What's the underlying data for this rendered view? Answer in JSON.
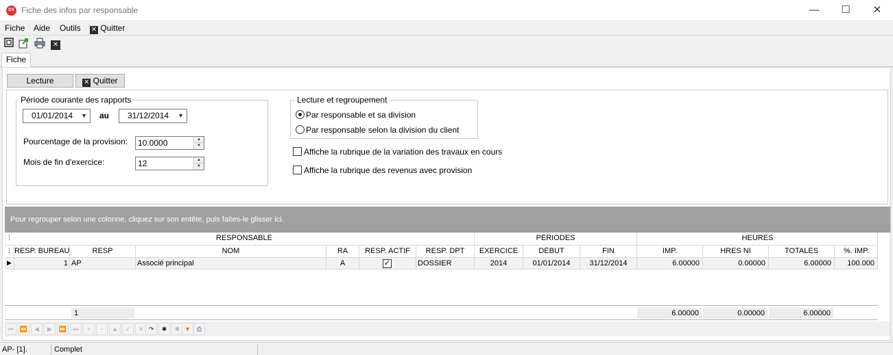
{
  "window": {
    "app_icon_text": "OX",
    "title": "Fiche des infos par responsable",
    "minimize": "—",
    "maximize": "☐",
    "close": "✕"
  },
  "menu": {
    "fiche": "Fiche",
    "aide": "Aide",
    "outils": "Outils",
    "quitter": "Quitter"
  },
  "toolbar": {
    "icons": [
      "frame-icon",
      "export-icon",
      "print-icon",
      "close-icon"
    ]
  },
  "tabs": {
    "fiche": "Fiche"
  },
  "actions": {
    "lecture": "Lecture",
    "quitter": "Quitter"
  },
  "periode": {
    "title": "Période courante des rapports",
    "start": "01/01/2014",
    "au": "au",
    "end": "31/12/2014",
    "provision_label": "Pourcentage de la provision:",
    "provision_value": "10.0000",
    "mois_label": "Mois de fin d'exercice:",
    "mois_value": "12"
  },
  "regroupement": {
    "title": "Lecture et regroupement",
    "option1": "Par responsable et sa division",
    "option2": "Par responsable selon la division du client",
    "selected": 1
  },
  "checks": {
    "variation": "Affiche la rubrique de la variation des travaux en cours",
    "revenus": "Affiche la rubrique des revenus avec provision"
  },
  "grid": {
    "group_hint": "Pour regrouper selon une colonne, cliquez sur son entête, puis faites-le glisser ici.",
    "bands": {
      "responsable": "RESPONSABLE",
      "periodes": "PÉRIODES",
      "heures": "HEURES"
    },
    "columns": {
      "resp_bureau": "RESP. BUREAU",
      "resp": "RESP",
      "nom": "NOM",
      "ra": "RA",
      "resp_actif": "RESP. ACTIF",
      "resp_dpt": "RESP. DPT",
      "exercice": "EXERCICE",
      "debut": "DÉBUT",
      "fin": "FIN",
      "imp": "IMP.",
      "hres_ni": "HRES NI",
      "totales": "TOTALES",
      "pct_imp": "%. IMP."
    },
    "rows": [
      {
        "resp_bureau": "1",
        "resp": "AP",
        "nom": "Associé principal",
        "ra": "A",
        "resp_actif": true,
        "resp_dpt": "DOSSIER",
        "exercice": "2014",
        "debut": "01/01/2014",
        "fin": "31/12/2014",
        "imp": "6.00000",
        "hres_ni": "0.00000",
        "totales": "6.00000",
        "pct_imp": "100.000"
      }
    ],
    "footer": {
      "count": "1",
      "imp": "6.00000",
      "hres_ni": "0.00000",
      "totales": "6.00000"
    }
  },
  "status": {
    "left": "AP- [1].",
    "state": "Complet"
  }
}
